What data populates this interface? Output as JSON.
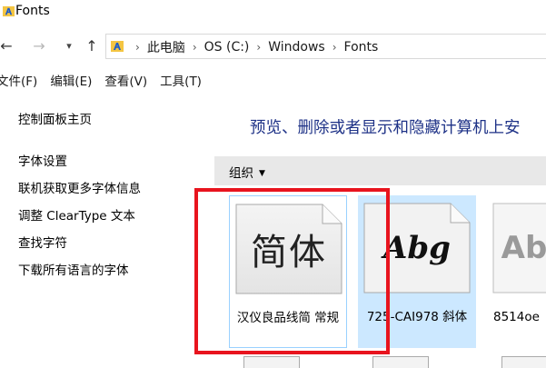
{
  "window": {
    "title": "Fonts"
  },
  "addressbar": {
    "crumbs": [
      "此电脑",
      "OS (C:)",
      "Windows",
      "Fonts"
    ]
  },
  "menubar": {
    "items": [
      "文件(F)",
      "编辑(E)",
      "查看(V)",
      "工具(T)"
    ]
  },
  "leftpane": {
    "home": "控制面板主页",
    "links": [
      "字体设置",
      "联机获取更多字体信息",
      "调整 ClearType 文本",
      "查找字符",
      "下载所有语言的字体"
    ]
  },
  "main": {
    "header": "预览、删除或者显示和隐藏计算机上安",
    "organize_label": "组织",
    "fonts": [
      {
        "preview": "简体",
        "label": "汉仪良品线简 常规"
      },
      {
        "preview": "Abg",
        "label": "725-CAI978 斜体"
      },
      {
        "preview": "Ab",
        "label": "8514oe"
      }
    ]
  },
  "colors": {
    "accent_title": "#1e3287",
    "selection": "#cce8ff",
    "highlight_box": "#e8141e"
  }
}
